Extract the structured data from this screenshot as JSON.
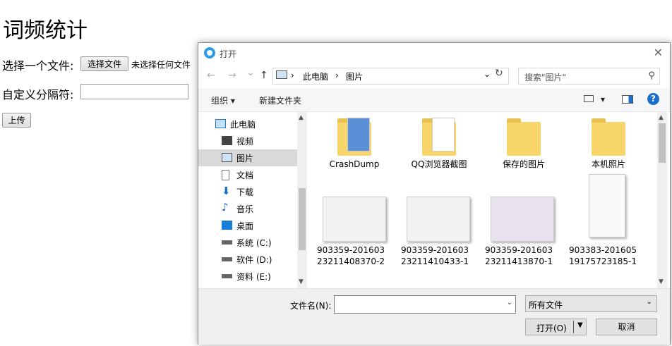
{
  "page": {
    "title": "词频统计",
    "choose_file_label": "选择一个文件:",
    "choose_file_button": "选择文件",
    "no_file_text": "未选择任何文件",
    "separator_label": "自定义分隔符:",
    "separator_value": "",
    "upload_button": "上传"
  },
  "dialog": {
    "title": "打开",
    "close": "✕",
    "nav": {
      "back": "←",
      "forward": "→",
      "history": "⌄",
      "up": "↑"
    },
    "address": {
      "sep": "›",
      "crumbs": [
        "此电脑",
        "图片"
      ],
      "dropdown": "⌄",
      "refresh": "↻"
    },
    "search_placeholder": "搜索\"图片\"",
    "toolbar": {
      "organize": "组织 ▾",
      "new_folder": "新建文件夹",
      "view_dropdown": "▾",
      "help": "?"
    },
    "sidebar": [
      {
        "label": "此电脑",
        "icon": "pc-icon"
      },
      {
        "label": "视频",
        "icon": "video-icon"
      },
      {
        "label": "图片",
        "icon": "pictures-icon",
        "selected": true
      },
      {
        "label": "文档",
        "icon": "documents-icon"
      },
      {
        "label": "下载",
        "icon": "download-icon"
      },
      {
        "label": "音乐",
        "icon": "music-icon"
      },
      {
        "label": "桌面",
        "icon": "desktop-icon"
      },
      {
        "label": "系统 (C:)",
        "icon": "drive-icon"
      },
      {
        "label": "软件 (D:)",
        "icon": "drive-icon"
      },
      {
        "label": "资料 (E:)",
        "icon": "drive-icon"
      }
    ],
    "items": [
      {
        "type": "folder",
        "name": "CrashDump"
      },
      {
        "type": "folder",
        "name": "QQ浏览器截图"
      },
      {
        "type": "folder",
        "name": "保存的图片"
      },
      {
        "type": "folder",
        "name": "本机照片"
      },
      {
        "type": "image",
        "name": "903359-201603\n23211408370-2"
      },
      {
        "type": "image",
        "name": "903359-201603\n23211410433-1"
      },
      {
        "type": "image",
        "name": "903359-201603\n23211413870-1"
      },
      {
        "type": "image",
        "name": "903383-201605\n19175723185-1"
      }
    ],
    "footer": {
      "filename_label": "文件名(N):",
      "filename_value": "",
      "filetype": "所有文件",
      "dropdown": "⌄",
      "split_arrow": "▼",
      "open_button": "打开(O)",
      "cancel_button": "取消"
    }
  }
}
